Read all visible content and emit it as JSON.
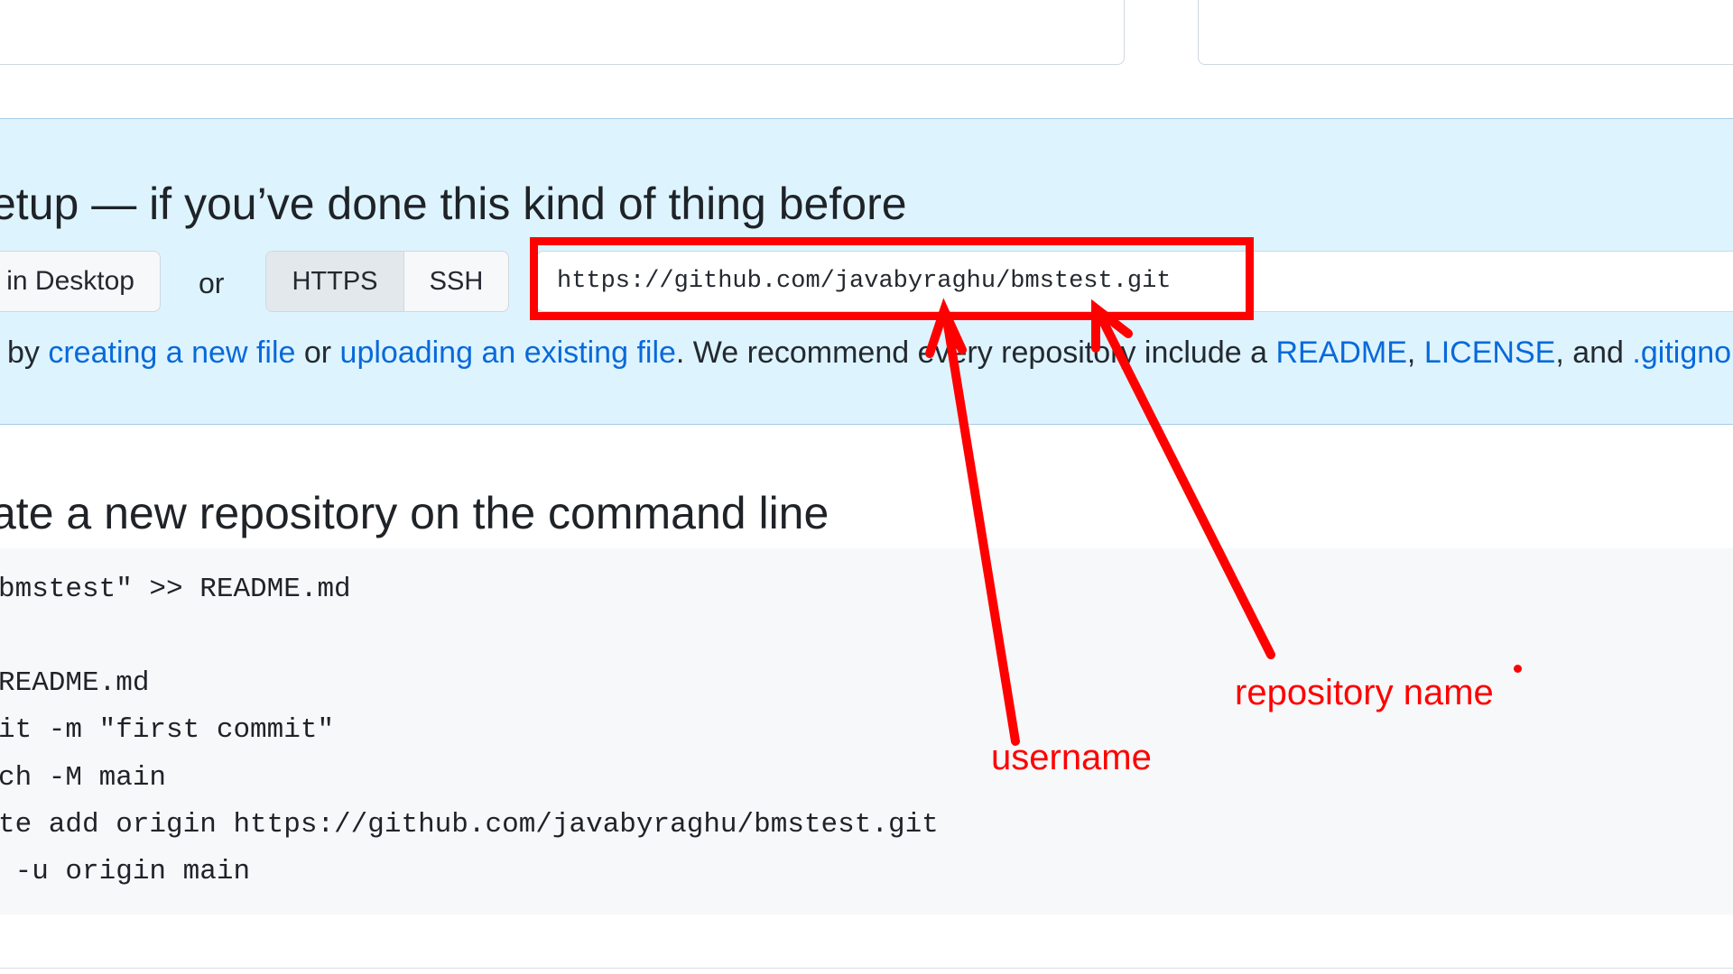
{
  "quick_setup": {
    "title": "etup — if you’ve done this kind of thing before",
    "desktop_button": "in Desktop",
    "or_text": "or",
    "https_button": "HTTPS",
    "ssh_button": "SSH",
    "clone_url": "https://github.com/javabyraghu/bmstest.git",
    "help": {
      "prefix": "by ",
      "link_new_file": "creating a new file",
      "mid1": " or ",
      "link_upload": "uploading an existing file",
      "mid2": ". We recommend every repository include a ",
      "link_readme": "README",
      "comma": ", ",
      "link_license": "LICENSE",
      "mid3": ", and ",
      "link_gitignore": ".gitignore"
    }
  },
  "command_line": {
    "title": "ate a new repository on the command line",
    "lines": [
      "bmstest\" >> README.md",
      "",
      "README.md",
      "it -m \"first commit\"",
      "ch -M main",
      "te add origin https://github.com/javabyraghu/bmstest.git",
      " -u origin main"
    ]
  },
  "annotations": {
    "username_label": "username",
    "repository_label": "repository name",
    "annotation_color": "#ff0000"
  },
  "colors": {
    "setup_background": "#ddf4ff",
    "link": "#0969da",
    "code_background": "#f6f8fa"
  }
}
